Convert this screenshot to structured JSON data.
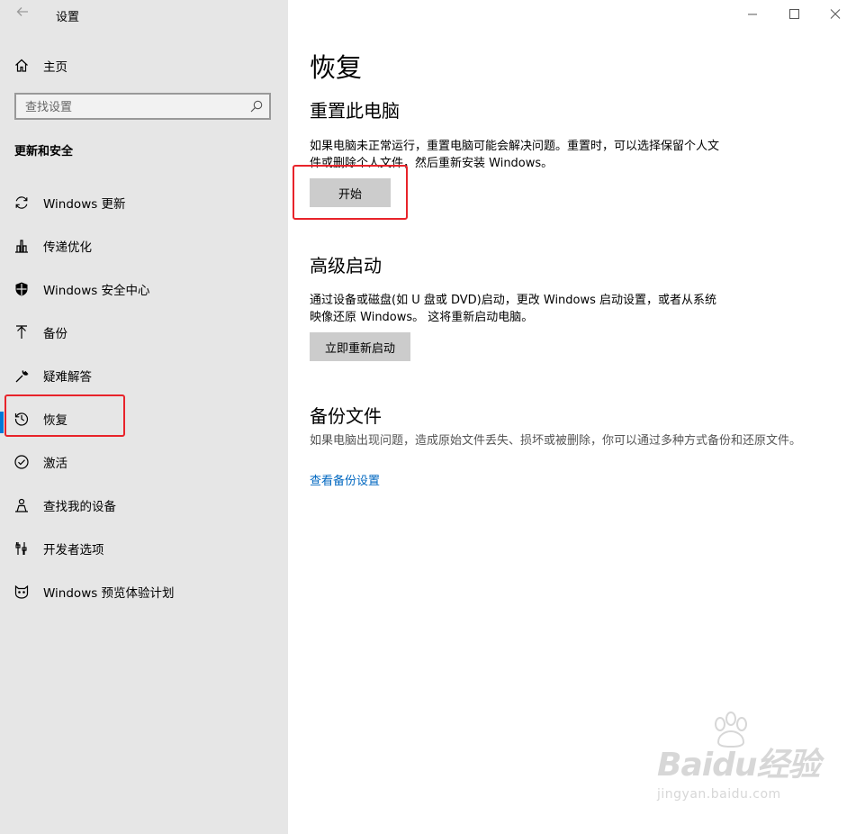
{
  "app": {
    "title": "设置",
    "back_icon": "back-arrow-icon"
  },
  "window_controls": [
    "minimize-icon",
    "maximize-icon",
    "close-icon"
  ],
  "sidebar": {
    "home_label": "主页",
    "search_placeholder": "查找设置",
    "section_header": "更新和安全",
    "items": [
      {
        "label": "Windows 更新",
        "icon": "sync-icon"
      },
      {
        "label": "传递优化",
        "icon": "delivery-optimization-icon"
      },
      {
        "label": "Windows 安全中心",
        "icon": "shield-icon"
      },
      {
        "label": "备份",
        "icon": "backup-arrow-icon"
      },
      {
        "label": "疑难解答",
        "icon": "wrench-icon"
      },
      {
        "label": "恢复",
        "icon": "history-icon",
        "selected": true
      },
      {
        "label": "激活",
        "icon": "check-circle-icon"
      },
      {
        "label": "查找我的设备",
        "icon": "person-location-icon"
      },
      {
        "label": "开发者选项",
        "icon": "developer-tools-icon"
      },
      {
        "label": "Windows 预览体验计划",
        "icon": "insider-cat-icon"
      }
    ],
    "accent_color": "#0078d7"
  },
  "main": {
    "title": "恢复",
    "reset": {
      "heading": "重置此电脑",
      "description": "如果电脑未正常运行，重置电脑可能会解决问题。重置时，可以选择保留个人文件或删除个人文件，然后重新安装 Windows。",
      "button": "开始"
    },
    "advanced": {
      "heading": "高级启动",
      "description": "通过设备或磁盘(如 U 盘或 DVD)启动，更改 Windows 启动设置，或者从系统映像还原 Windows。 这将重新启动电脑。",
      "button": "立即重新启动"
    },
    "backup": {
      "heading": "备份文件",
      "description": "如果电脑出现问题，造成原始文件丢失、损坏或被删除，你可以通过多种方式备份和还原文件。",
      "link": "查看备份设置"
    }
  },
  "watermark": {
    "brand": "Baidu经验",
    "url": "jingyan.baidu.com"
  },
  "highlight_color": "#e8232a"
}
